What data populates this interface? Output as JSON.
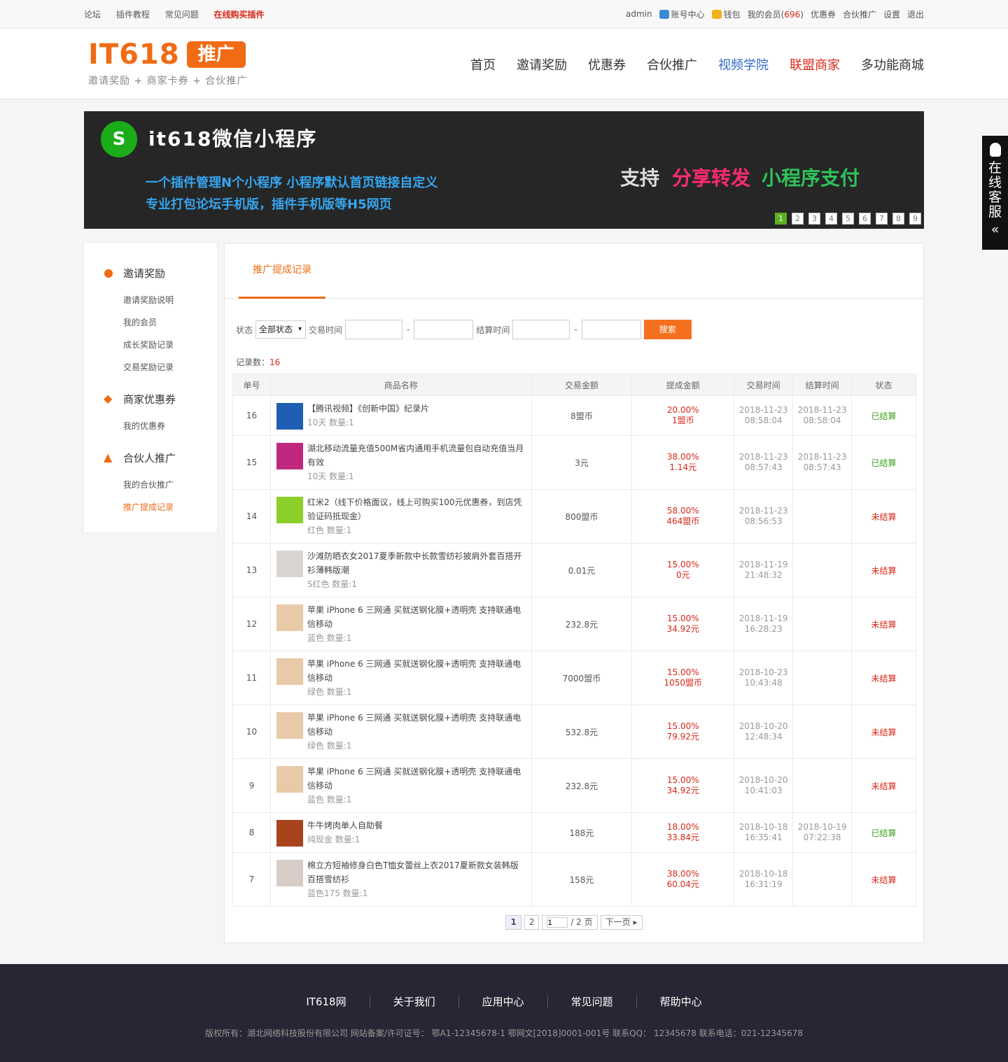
{
  "topbar": {
    "links": [
      "论坛",
      "插件教程",
      "常见问题",
      "在线购买插件"
    ],
    "user": "admin",
    "account": "账号中心",
    "wallet": "钱包",
    "members_label": "我的会员(",
    "members_count": "696",
    "members_close": ")",
    "coupon": "优惠券",
    "partner": "合伙推广",
    "settings": "设置",
    "logout": "退出"
  },
  "logo": {
    "main": "IT618",
    "tag": "推广",
    "sub": "邀请奖励 + 商家卡券 + 合伙推广"
  },
  "nav": [
    "首页",
    "邀请奖励",
    "优惠券",
    "合伙推广",
    "视频学院",
    "联盟商家",
    "多功能商城"
  ],
  "banner": {
    "title": "it618微信小程序",
    "line1": "一个插件管理N个小程序  小程序默认首页链接自定义",
    "line2": "专业打包论坛手机版，插件手机版等H5网页",
    "support": "支持",
    "feat1": "分享转发",
    "feat2": "小程序支付",
    "dots": [
      "1",
      "2",
      "3",
      "4",
      "5",
      "6",
      "7",
      "8",
      "9"
    ]
  },
  "side_service": "在线客服",
  "sidebar": {
    "groups": [
      {
        "title": "邀请奖励",
        "icon": "user-icon",
        "items": [
          "邀请奖励说明",
          "我的会员",
          "成长奖励记录",
          "交易奖励记录"
        ]
      },
      {
        "title": "商家优惠券",
        "icon": "layers-icon",
        "items": [
          "我的优惠券"
        ]
      },
      {
        "title": "合伙人推广",
        "icon": "chart-icon",
        "items": [
          "我的合伙推广",
          "推广提成记录"
        ]
      }
    ],
    "active": "推广提成记录"
  },
  "tab": "推广提成记录",
  "filter": {
    "status_label": "状态",
    "status_value": "全部状态",
    "trade_label": "交易时间",
    "settle_label": "结算时间",
    "dash": "-",
    "search": "搜索"
  },
  "records": {
    "label": "记录数：",
    "count": "16"
  },
  "table": {
    "headers": [
      "单号",
      "商品名称",
      "交易金额",
      "提成金额",
      "交易时间",
      "结算时间",
      "状态"
    ],
    "rows": [
      {
        "id": "16",
        "name": "【腾讯视频】《创新中国》纪录片",
        "meta": "10天 数量:1",
        "amount": "8盟币",
        "pct": "20.00%",
        "comm": "1盟币",
        "t1": "2018-11-23",
        "t2": "08:58:04",
        "s1": "2018-11-23",
        "s2": "08:58:04",
        "status": "已结算",
        "ok": true,
        "thumb": "#1e5fb3"
      },
      {
        "id": "15",
        "name": "湖北移动流量充值500M省内通用手机流量包自动充值当月有效",
        "meta": "10天 数量:1",
        "amount": "3元",
        "pct": "38.00%",
        "comm": "1.14元",
        "t1": "2018-11-23",
        "t2": "08:57:43",
        "s1": "2018-11-23",
        "s2": "08:57:43",
        "status": "已结算",
        "ok": true,
        "thumb": "#c0287f"
      },
      {
        "id": "14",
        "name": "红米2（线下价格面议，线上可购买100元优惠券，到店凭验证码抵现金）",
        "meta": "红色 数量:1",
        "amount": "800盟币",
        "pct": "58.00%",
        "comm": "464盟币",
        "t1": "2018-11-23",
        "t2": "08:56:53",
        "s1": "",
        "s2": "",
        "status": "未结算",
        "ok": false,
        "thumb": "#8ccf2a"
      },
      {
        "id": "13",
        "name": "沙滩防晒衣女2017夏季新款中长款雪纺衫披肩外套百搭开衫薄韩版潮",
        "meta": "S红色 数量:1",
        "amount": "0.01元",
        "pct": "15.00%",
        "comm": "0元",
        "t1": "2018-11-19",
        "t2": "21:48:32",
        "s1": "",
        "s2": "",
        "status": "未结算",
        "ok": false,
        "thumb": "#d9d4cf"
      },
      {
        "id": "12",
        "name": "苹果 iPhone 6 三网通 买就送钢化膜+透明壳 支持联通电信移动",
        "meta": "蓝色 数量:1",
        "amount": "232.8元",
        "pct": "15.00%",
        "comm": "34.92元",
        "t1": "2018-11-19",
        "t2": "16:28:23",
        "s1": "",
        "s2": "",
        "status": "未结算",
        "ok": false,
        "thumb": "#e8c9a8"
      },
      {
        "id": "11",
        "name": "苹果 iPhone 6 三网通 买就送钢化膜+透明壳 支持联通电信移动",
        "meta": "绿色 数量:1",
        "amount": "7000盟币",
        "pct": "15.00%",
        "comm": "1050盟币",
        "t1": "2018-10-23",
        "t2": "10:43:48",
        "s1": "",
        "s2": "",
        "status": "未结算",
        "ok": false,
        "thumb": "#e8c9a8"
      },
      {
        "id": "10",
        "name": "苹果 iPhone 6 三网通 买就送钢化膜+透明壳 支持联通电信移动",
        "meta": "绿色 数量:1",
        "amount": "532.8元",
        "pct": "15.00%",
        "comm": "79.92元",
        "t1": "2018-10-20",
        "t2": "12:48:34",
        "s1": "",
        "s2": "",
        "status": "未结算",
        "ok": false,
        "thumb": "#e8c9a8"
      },
      {
        "id": "9",
        "name": "苹果 iPhone 6 三网通 买就送钢化膜+透明壳 支持联通电信移动",
        "meta": "蓝色 数量:1",
        "amount": "232.8元",
        "pct": "15.00%",
        "comm": "34.92元",
        "t1": "2018-10-20",
        "t2": "10:41:03",
        "s1": "",
        "s2": "",
        "status": "未结算",
        "ok": false,
        "thumb": "#e8c9a8"
      },
      {
        "id": "8",
        "name": "牛牛烤肉单人自助餐",
        "meta": "纯现金 数量:1",
        "amount": "188元",
        "pct": "18.00%",
        "comm": "33.84元",
        "t1": "2018-10-18",
        "t2": "16:35:41",
        "s1": "2018-10-19",
        "s2": "07:22:38",
        "status": "已结算",
        "ok": true,
        "thumb": "#a8431c"
      },
      {
        "id": "7",
        "name": "棉立方短袖修身白色T恤女蕾丝上衣2017夏新款女装韩版百搭雪纺衫",
        "meta": "蓝色175 数量:1",
        "amount": "158元",
        "pct": "38.00%",
        "comm": "60.04元",
        "t1": "2018-10-18",
        "t2": "16:31:19",
        "s1": "",
        "s2": "",
        "status": "未结算",
        "ok": false,
        "thumb": "#d8ccc6"
      }
    ]
  },
  "pager": {
    "p1": "1",
    "p2": "2",
    "input": "1",
    "total": "/ 2 页",
    "next": "下一页"
  },
  "footer": {
    "links": [
      "IT618网",
      "关于我们",
      "应用中心",
      "常见问题",
      "帮助中心"
    ],
    "copyright": "版权所有：湖北网络科技股份有限公司 网站备案/许可证号： 鄂A1-12345678-1 鄂网文[2018]0001-001号 联系QQ： 12345678 联系电话：021-12345678"
  }
}
